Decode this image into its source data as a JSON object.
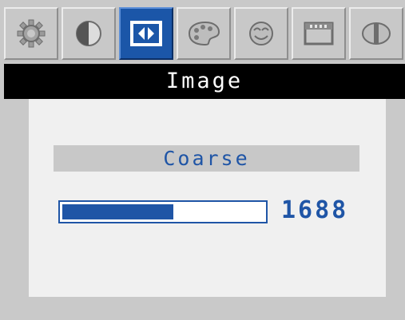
{
  "tabs": [
    {
      "icon": "sun-brightness-icon",
      "active": false
    },
    {
      "icon": "contrast-half-circle-icon",
      "active": false
    },
    {
      "icon": "image-settings-icon",
      "active": true
    },
    {
      "icon": "color-palette-icon",
      "active": false
    },
    {
      "icon": "face-icon",
      "active": false
    },
    {
      "icon": "menu-window-icon",
      "active": false
    },
    {
      "icon": "reset-circle-icon",
      "active": false
    }
  ],
  "title": "Image",
  "parameter": {
    "label": "Coarse",
    "value": "1688",
    "level_fraction": 0.55
  },
  "colors": {
    "accent": "#1f55a6",
    "active_tab": "#1b56a8",
    "title_bar": "#000000",
    "panel": "#f0f0f0",
    "frame": "#c9c9c9"
  }
}
